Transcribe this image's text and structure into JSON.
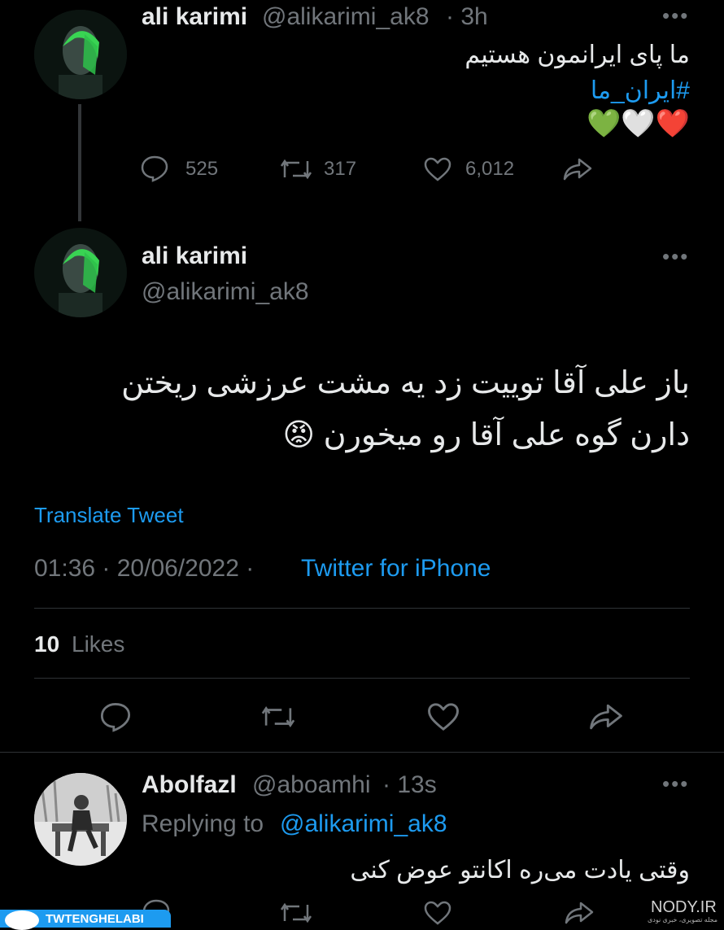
{
  "tweet1": {
    "name": "ali karimi",
    "handle": "@alikarimi_ak8",
    "time": "· 3h",
    "text_line1": "ما پای ایرانمون هستیم",
    "hashtag": "#ایران_ما",
    "hearts": "❤️🤍💚",
    "replies": "525",
    "retweets": "317",
    "likes": "6,012"
  },
  "tweet2": {
    "name": "ali karimi",
    "handle": "@alikarimi_ak8",
    "text_line1": "باز علی آقا توییت زد یه مشت عرزشی ریختن",
    "text_line2": "دارن گوه علی آقا رو میخورن 😡",
    "translate": "Translate Tweet",
    "time": "01:36 · 20/06/2022 ·",
    "client": "Twitter for iPhone",
    "likes_count": "10",
    "likes_label": "Likes"
  },
  "reply": {
    "name": "Abolfazl",
    "handle": "@aboamhi",
    "time": "· 13s",
    "replying_prefix": "Replying to",
    "replying_handle": "@alikarimi_ak8",
    "text": "وقتی یادت می‌ره اکانتو عوض کنی"
  },
  "watermarks": {
    "left": "TWTENGHELABI",
    "right": "NODY.IR",
    "right_sub": "مجله تصویری، خبری نودی"
  },
  "colors": {
    "accent": "#1d9bf0",
    "muted": "#71767b",
    "text": "#e7e9ea",
    "green": "#39d353"
  }
}
